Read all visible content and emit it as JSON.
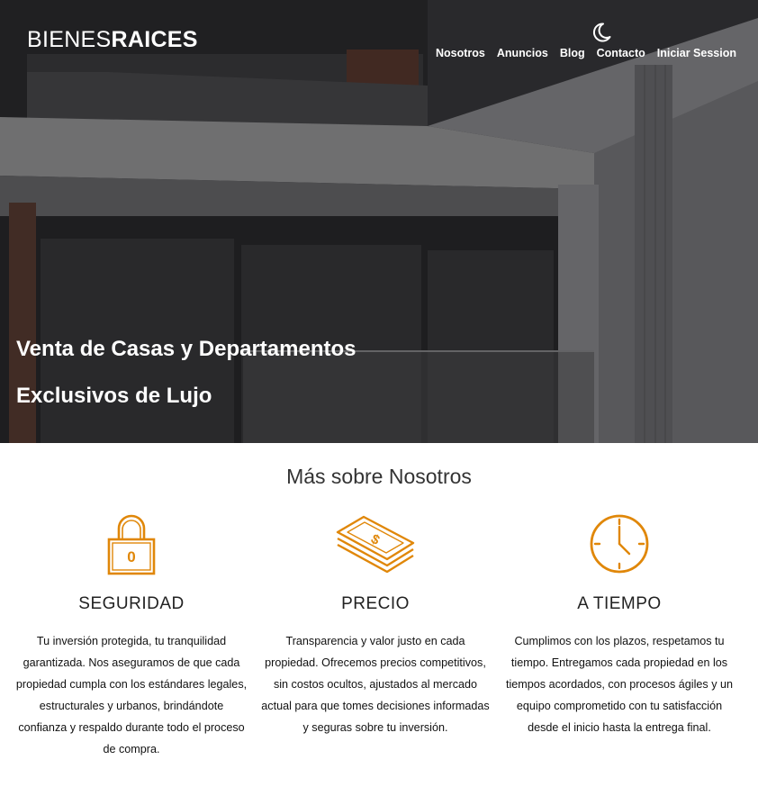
{
  "header": {
    "logo_light": "BIENES",
    "logo_bold": "RAICES",
    "nav": [
      "Nosotros",
      "Anuncios",
      "Blog",
      "Contacto",
      "Iniciar Session"
    ],
    "dark_mode_icon": "moon-icon"
  },
  "hero": {
    "title_line1": "Venta de Casas y Departamentos",
    "title_line2": "Exclusivos de Lujo"
  },
  "about": {
    "title": "Más sobre Nosotros",
    "features": [
      {
        "icon": "lock-icon",
        "heading": "SEGURIDAD",
        "text": "Tu inversión protegida, tu tranquilidad garantizada. Nos aseguramos de que cada propiedad cumpla con los estándares legales, estructurales y urbanos, brindándote confianza y respaldo durante todo el proceso de compra."
      },
      {
        "icon": "money-stack-icon",
        "heading": "PRECIO",
        "text": "Transparencia y valor justo en cada propiedad. Ofrecemos precios competitivos, sin costos ocultos, ajustados al mercado actual para que tomes decisiones informadas y seguras sobre tu inversión."
      },
      {
        "icon": "clock-icon",
        "heading": "A TIEMPO",
        "text": "Cumplimos con los plazos, respetamos tu tiempo. Entregamos cada propiedad en los tiempos acordados, con procesos ágiles y un equipo comprometido con tu satisfacción desde el inicio hasta la entrega final."
      }
    ]
  },
  "colors": {
    "accent": "#E08709"
  }
}
